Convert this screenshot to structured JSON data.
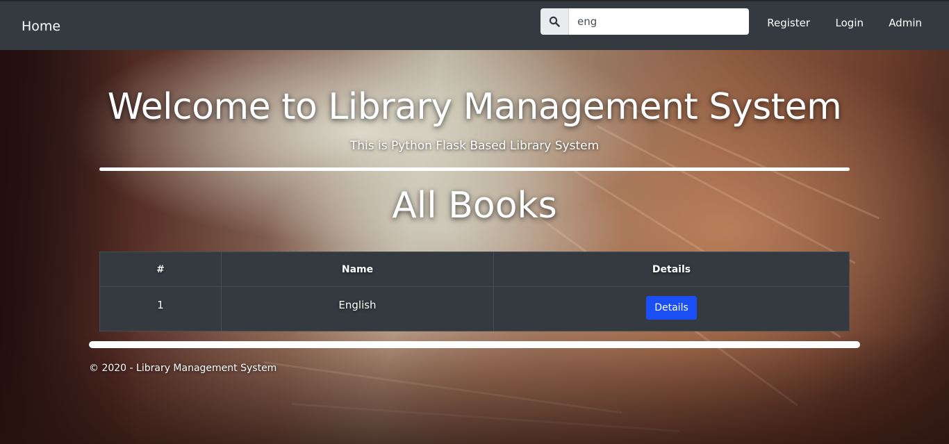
{
  "navbar": {
    "brand": "Home",
    "search": {
      "value": "eng",
      "icon": "search-icon"
    },
    "links": [
      "Register",
      "Login",
      "Admin"
    ]
  },
  "hero": {
    "title": "Welcome to Library Management System",
    "subtitle": "This is Python Flask Based Library System"
  },
  "section": {
    "title": "All Books"
  },
  "table": {
    "headers": [
      "#",
      "Name",
      "Details"
    ],
    "rows": [
      {
        "num": "1",
        "name": "English",
        "action": "Details"
      }
    ]
  },
  "footer": {
    "text": "© 2020 - Library Management System"
  },
  "colors": {
    "navbar": "#343a40",
    "button": "#1a4ff5"
  }
}
